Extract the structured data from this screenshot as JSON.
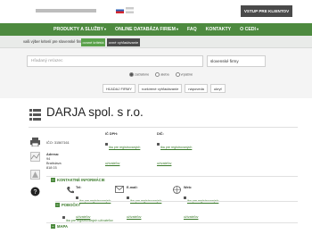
{
  "topbar": {
    "login_label": "VSTUP PRE KLIENTOV"
  },
  "nav": {
    "items": [
      {
        "label": "PRODUKTY A SLUŽBY",
        "caret": true
      },
      {
        "label": "ONLINE DATABÁZA FIRIEM",
        "caret": true
      },
      {
        "label": "FAQ",
        "caret": false
      },
      {
        "label": "KONTAKTY",
        "caret": false
      },
      {
        "label": "O CEDI",
        "caret": true
      }
    ]
  },
  "subbar": {
    "label": "vaši výber kriterií pre slovenské firmy",
    "basic_button": "ovoné kritériá",
    "advanced_button": "ovné vyhľadávanie"
  },
  "search": {
    "placeholder": "Hľadaný reťazec",
    "country_select": "slovenské firmy",
    "radios": [
      {
        "label": "začiatone",
        "checked": true
      },
      {
        "label": "aleba",
        "checked": false
      },
      {
        "label": "vrpášné",
        "checked": false
      }
    ],
    "buttons": [
      "HĽADAJ FIRMY",
      "rozšírené vyhľadávanie",
      "nápoveda",
      "ukryť"
    ]
  },
  "company": {
    "name": "DARJA spol. s r.o.",
    "ico_label": "IČO:",
    "ico_value": "31567161",
    "address_label": "Adresa:",
    "address_lines": [
      "94",
      "Bratislava",
      "818 03"
    ],
    "ic_dph_label": "IČ DPH:",
    "dic_label": "DIČ:",
    "restricted_link": "iba pre registrovaných užívateľov"
  },
  "contacts": {
    "section_title": "KONTAKTNÉ INFORMÁCIE",
    "tel_label": "Tel:",
    "email_label": "E-mail:",
    "web_label": "Web:",
    "restricted_link": "iba pre registrovaných užívateľov"
  },
  "branches": {
    "section_title": "POBOČKY",
    "restricted_link": "iba pre registrovaných užívateľov"
  },
  "map": {
    "section_title": "MAPA"
  },
  "colors": {
    "nav_green": "#4d8a3f",
    "link_green": "#3a7a2a",
    "dark_button": "#4a4a4a"
  }
}
